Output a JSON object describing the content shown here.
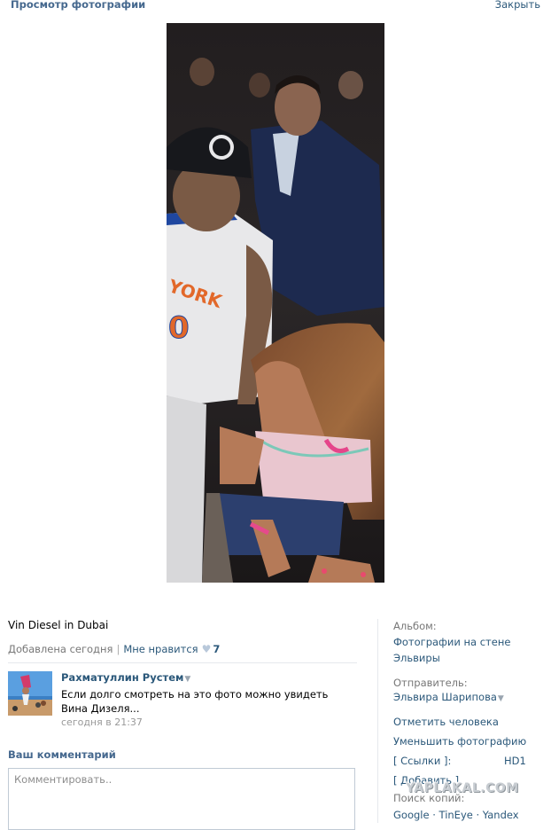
{
  "header": {
    "title": "Просмотр фотографии",
    "close_label": "Закрыть"
  },
  "photo": {
    "alt": "Vin Diesel in Dubai"
  },
  "caption": "Vin Diesel in Dubai",
  "meta": {
    "added": "Добавлена сегодня",
    "separator": "|",
    "like_label": "Мне нравится",
    "like_count": "7"
  },
  "comment": {
    "author": "Рахматуллин Рустем",
    "text": "Если долго смотреть на это фото можно увидеть Вина Дизеля...",
    "time": "сегодня в 21:37"
  },
  "compose": {
    "heading": "Ваш комментарий",
    "placeholder": "Комментировать.."
  },
  "sidebar": {
    "album_heading": "Альбом:",
    "album_line1": "Фотографии на стене",
    "album_line2": "Эльвиры",
    "sender_heading": "Отправитель:",
    "sender_name": "Эльвира Шарипова",
    "tag_person": "Отметить человека",
    "shrink_photo": "Уменьшить фотографию",
    "links": "[ Ссылки ]:",
    "hd": "HD1",
    "add": "[ Добавить ]",
    "search_copies": "Поиск копий:",
    "engines": "Google · TinEye · Yandex"
  },
  "watermark": "YAPLAKAL.COM",
  "colors": {
    "link": "#2b587a",
    "heading": "#45688e",
    "muted": "#777777"
  }
}
